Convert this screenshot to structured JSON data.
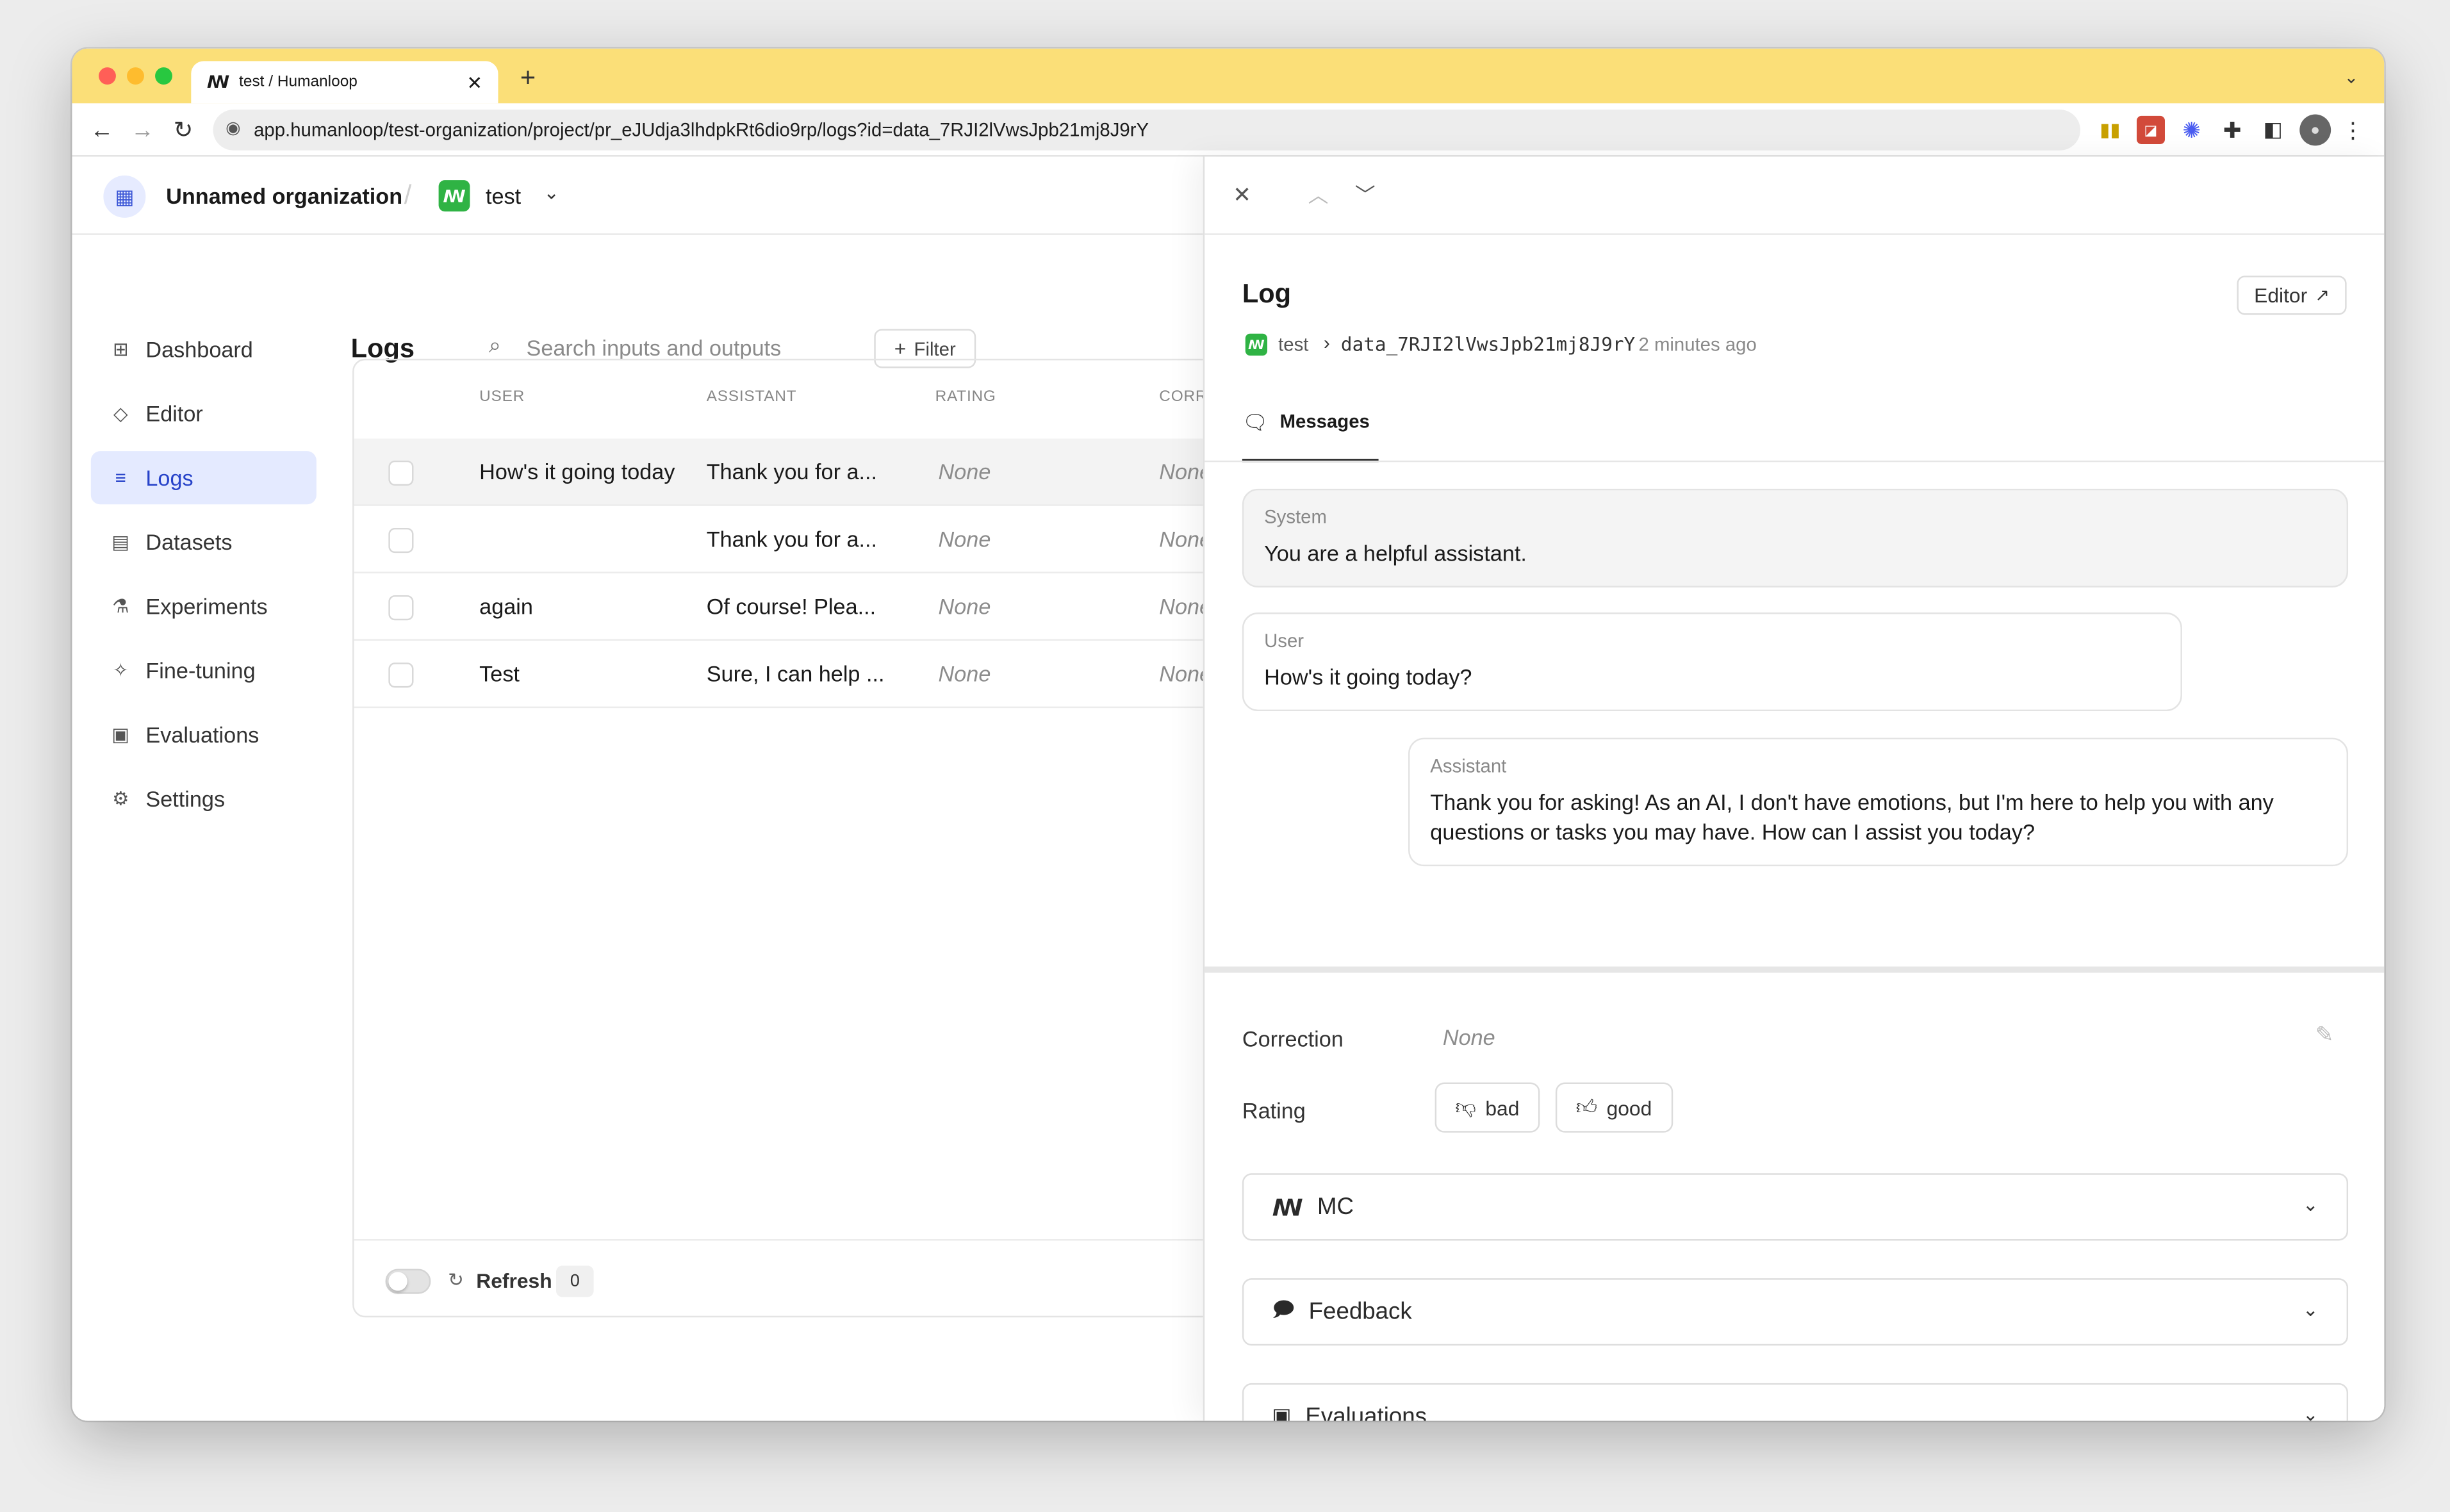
{
  "browser": {
    "tab_title": "test / Humanloop",
    "new_tab": "+",
    "url": "app.humanloop/test-organization/project/pr_eJUdja3lhdpkRt6dio9rp/logs?id=data_7RJI2lVwsJpb21mj8J9rY"
  },
  "header": {
    "org_name": "Unnamed organization",
    "separator": "/",
    "project_name": "test"
  },
  "sidebar": {
    "items": [
      {
        "label": "Dashboard",
        "icon": "grid-icon"
      },
      {
        "label": "Editor",
        "icon": "diamond-icon"
      },
      {
        "label": "Logs",
        "icon": "database-icon"
      },
      {
        "label": "Datasets",
        "icon": "stack-icon"
      },
      {
        "label": "Experiments",
        "icon": "flask-icon"
      },
      {
        "label": "Fine-tuning",
        "icon": "sparkle-icon"
      },
      {
        "label": "Evaluations",
        "icon": "clipboard-icon"
      },
      {
        "label": "Settings",
        "icon": "gear-icon"
      }
    ],
    "active": "Logs"
  },
  "logs": {
    "title": "Logs",
    "search_placeholder": "Search inputs and outputs",
    "filter_label": "Filter",
    "columns": [
      "USER",
      "ASSISTANT",
      "RATING",
      "CORR"
    ],
    "rows": [
      {
        "user": "How's it going today",
        "assistant": "Thank you for a...",
        "rating": "None",
        "correction": "None"
      },
      {
        "user": "",
        "assistant": "Thank you for a...",
        "rating": "None",
        "correction": "None"
      },
      {
        "user": "again",
        "assistant": "Of course! Plea...",
        "rating": "None",
        "correction": "None"
      },
      {
        "user": "Test",
        "assistant": "Sure, I can help ...",
        "rating": "None",
        "correction": "None"
      }
    ],
    "refresh_label": "Refresh",
    "refresh_count": "0"
  },
  "log_panel": {
    "title": "Log",
    "editor_button": "Editor",
    "breadcrumb_project": "test",
    "log_id": "data_7RJI2lVwsJpb21mj8J9rY",
    "time_ago": "2 minutes ago",
    "tab_messages": "Messages",
    "messages": [
      {
        "role": "System",
        "text": "You are a helpful assistant."
      },
      {
        "role": "User",
        "text": "How's it going today?"
      },
      {
        "role": "Assistant",
        "text": "Thank you for asking! As an AI, I don't have emotions, but I'm here to help you with any questions or tasks you may have. How can I assist you today?"
      }
    ],
    "correction_label": "Correction",
    "correction_value": "None",
    "rating_label": "Rating",
    "rating_bad": "bad",
    "rating_good": "good",
    "sections": [
      "MC",
      "Feedback",
      "Evaluations"
    ]
  },
  "colors": {
    "tabbar": "#fbdf78",
    "accent": "#2743c9",
    "brand_green": "#2fb344"
  }
}
